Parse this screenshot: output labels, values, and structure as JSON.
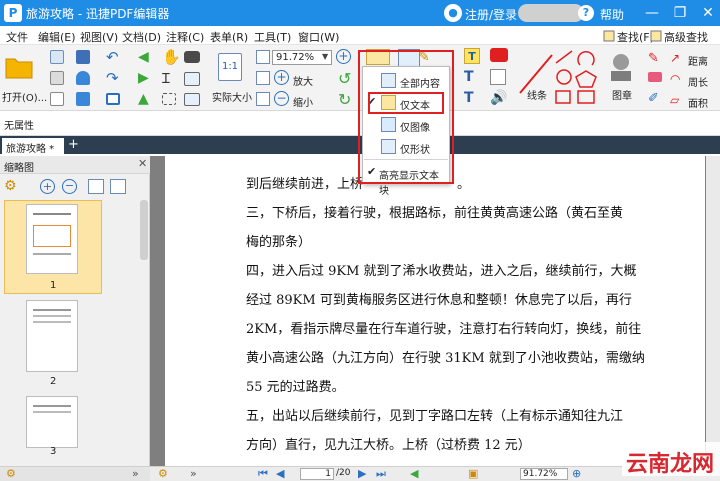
{
  "titlebar": {
    "app_title": "旅游攻略 - 迅捷PDF编辑器",
    "logo_letter": "P",
    "login_label": "注册/登录",
    "help_label": "帮助",
    "minimize": "—",
    "restore": "❐",
    "close": "✕"
  },
  "menu": {
    "items": [
      "文件",
      "编辑(E)",
      "视图(V)",
      "文档(D)",
      "注释(C)",
      "表单(R)",
      "工具(T)",
      "窗口(W)"
    ],
    "find_label": "查找(F)",
    "advanced_find_label": "高级查找"
  },
  "ribbon": {
    "open_label": "打开(O)...",
    "zoom_value": "91.72%",
    "actual_size_label": "实际大小",
    "actual_size_glyph": "1:1",
    "zoom_in_label": "放大",
    "zoom_out_label": "缩小",
    "line_label": "线条",
    "stamp_label": "图章",
    "distance_label": "距离",
    "perimeter_label": "周长",
    "area_label": "面积"
  },
  "property_bar": {
    "label": "无属性"
  },
  "tabs": {
    "active_tab": "旅游攻略 *",
    "add": "+"
  },
  "sidebar": {
    "title": "缩略图",
    "pages": [
      "1",
      "2",
      "3"
    ]
  },
  "document": {
    "lines": [
      "到后继续前进，上桥",
      "三，下桥后，接着行驶，根据路标，前往黄黄高速公路（黄石至黄",
      "梅的那条）",
      "四，进入后过 9KM 就到了浠水收费站，进入之后，继续前行，大概",
      "经过 89KM 可到黄梅服务区进行休息和整顿！休息完了以后，再行",
      "2KM，看指示牌尽量在行车道行驶，注意打右行转向灯，换线，前往",
      "黄小高速公路（九江方向）在行驶 31KM 就到了小池收费站，需缴纳",
      "55 元的过路费。",
      "五，出站以后继续前行，见到丁字路口左转（上有标示通知往九江",
      "方向）直行，见九江大桥。上桥（过桥费 12 元）"
    ],
    "line_tail": "。"
  },
  "dropdown": {
    "items": [
      "全部内容",
      "仅文本",
      "仅图像",
      "仅形状",
      "高亮显示文本块"
    ],
    "checked": [
      "仅文本",
      "高亮显示文本块"
    ]
  },
  "statusbar": {
    "page_current": "1",
    "page_total": "/20",
    "zoom_value": "91.72%"
  },
  "watermark": {
    "text": "云南龙网"
  },
  "colors": {
    "titlebar": "#1f8ce6",
    "highlight_red": "#e02020",
    "doc_bg": "#7f7f7f",
    "tab_bg": "#2c3e50"
  }
}
